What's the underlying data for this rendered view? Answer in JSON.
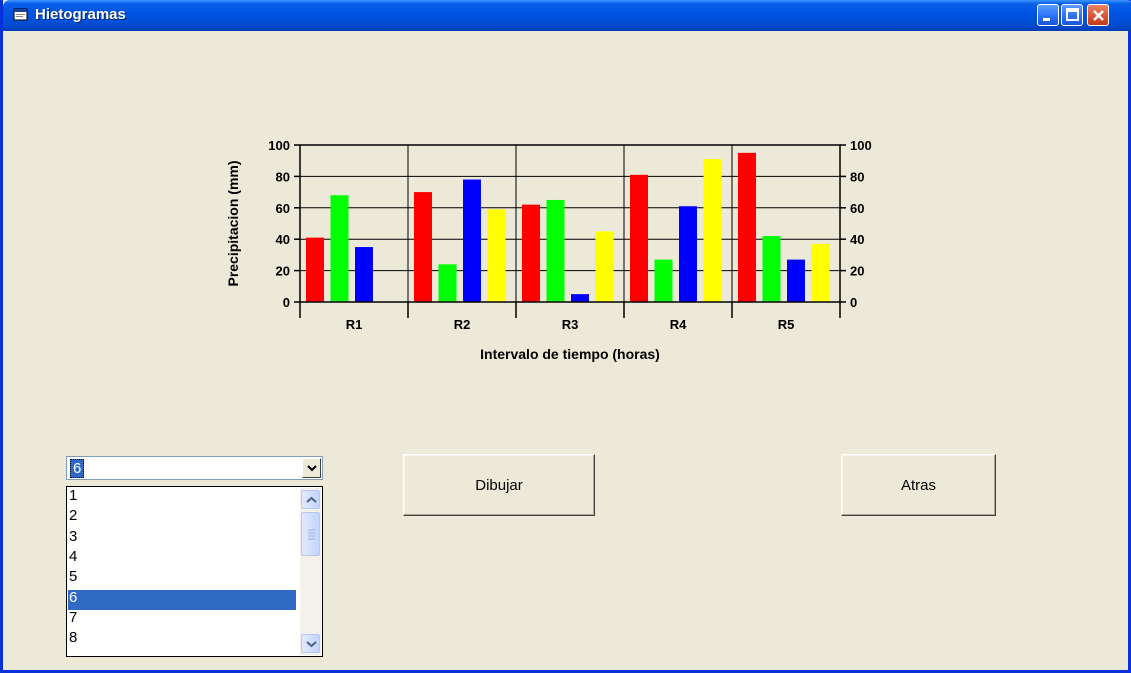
{
  "window": {
    "title": "Hietogramas"
  },
  "chart_data": {
    "type": "bar",
    "categories": [
      "R1",
      "R2",
      "R3",
      "R4",
      "R5"
    ],
    "series": [
      {
        "color": "#ff0000",
        "values": [
          41,
          70,
          62,
          81,
          95
        ]
      },
      {
        "color": "#00ff00",
        "values": [
          68,
          24,
          65,
          27,
          42
        ]
      },
      {
        "color": "#0000ff",
        "values": [
          35,
          78,
          5,
          61,
          27
        ]
      },
      {
        "color": "#ffff00",
        "values": [
          null,
          59,
          45,
          91,
          37
        ]
      }
    ],
    "xlabel": "Intervalo de tiempo (horas)",
    "ylabel": "Precipitacion (mm)",
    "ylim": [
      0,
      100
    ],
    "yticks": [
      0,
      20,
      40,
      60,
      80,
      100
    ],
    "secondary_y_axis": true,
    "grid": true
  },
  "combo": {
    "value": "6"
  },
  "list": {
    "items": [
      "1",
      "2",
      "3",
      "4",
      "5",
      "6",
      "7",
      "8"
    ],
    "selected": "6"
  },
  "buttons": {
    "draw": "Dibujar",
    "back": "Atras"
  }
}
